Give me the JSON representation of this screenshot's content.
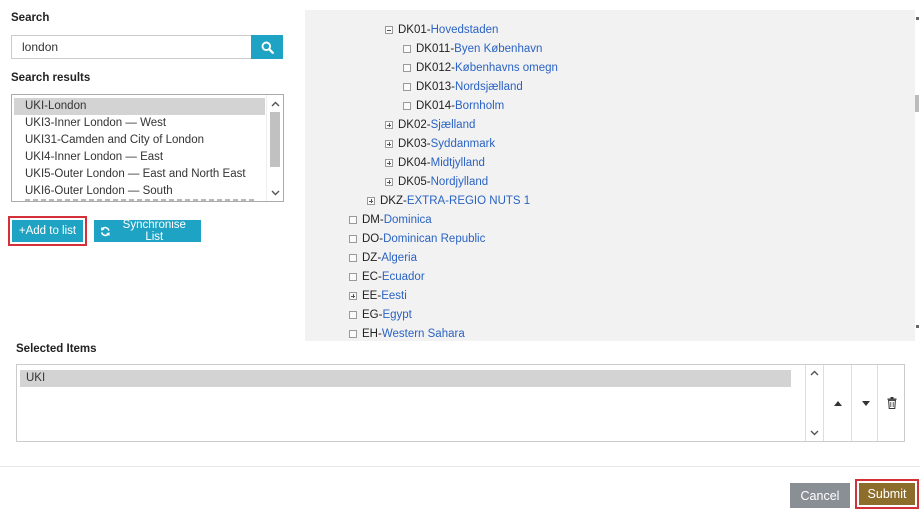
{
  "search": {
    "label": "Search",
    "value": "london",
    "button_icon": "search-icon"
  },
  "results": {
    "label": "Search results",
    "items": [
      "UKI-London",
      "UKI3-Inner London — West",
      "UKI31-Camden and City of London",
      "UKI4-Inner London — East",
      "UKI5-Outer London — East and North East",
      "UKI6-Outer London — South"
    ],
    "selected_index": 0
  },
  "buttons": {
    "add_to_list": "+Add to list",
    "synchronise": "Synchronise List",
    "synchronise_icon": "refresh-icon",
    "cancel": "Cancel",
    "submit": "Submit"
  },
  "tree": {
    "nodes": [
      {
        "toggle": "minus",
        "code": "DK01",
        "name": "Hovedstaden"
      },
      {
        "toggle": "none",
        "code": "DK011",
        "name": "Byen København"
      },
      {
        "toggle": "none",
        "code": "DK012",
        "name": "Københavns omegn"
      },
      {
        "toggle": "none",
        "code": "DK013",
        "name": "Nordsjælland"
      },
      {
        "toggle": "none",
        "code": "DK014",
        "name": "Bornholm"
      },
      {
        "toggle": "plus",
        "code": "DK02",
        "name": "Sjælland"
      },
      {
        "toggle": "plus",
        "code": "DK03",
        "name": "Syddanmark"
      },
      {
        "toggle": "plus",
        "code": "DK04",
        "name": "Midtjylland"
      },
      {
        "toggle": "plus",
        "code": "DK05",
        "name": "Nordjylland"
      },
      {
        "toggle": "plus",
        "code": "DKZ",
        "name": "EXTRA-REGIO NUTS 1"
      },
      {
        "toggle": "none",
        "code": "DM",
        "name": "Dominica"
      },
      {
        "toggle": "none",
        "code": "DO",
        "name": "Dominican Republic"
      },
      {
        "toggle": "none",
        "code": "DZ",
        "name": "Algeria"
      },
      {
        "toggle": "none",
        "code": "EC",
        "name": "Ecuador"
      },
      {
        "toggle": "plus",
        "code": "EE",
        "name": "Eesti"
      },
      {
        "toggle": "none",
        "code": "EG",
        "name": "Egypt"
      },
      {
        "toggle": "none",
        "code": "EH",
        "name": "Western Sahara"
      }
    ]
  },
  "selected": {
    "label": "Selected Items",
    "items": [
      "UKI"
    ],
    "move_up_icon": "caret-up-icon",
    "move_down_icon": "caret-down-icon",
    "delete_icon": "trash-icon"
  },
  "colors": {
    "accent": "#1fa3c4",
    "submit": "#8c6d2c",
    "cancel": "#8a8f96",
    "highlight": "#d3303a",
    "link": "#2a63c3"
  }
}
